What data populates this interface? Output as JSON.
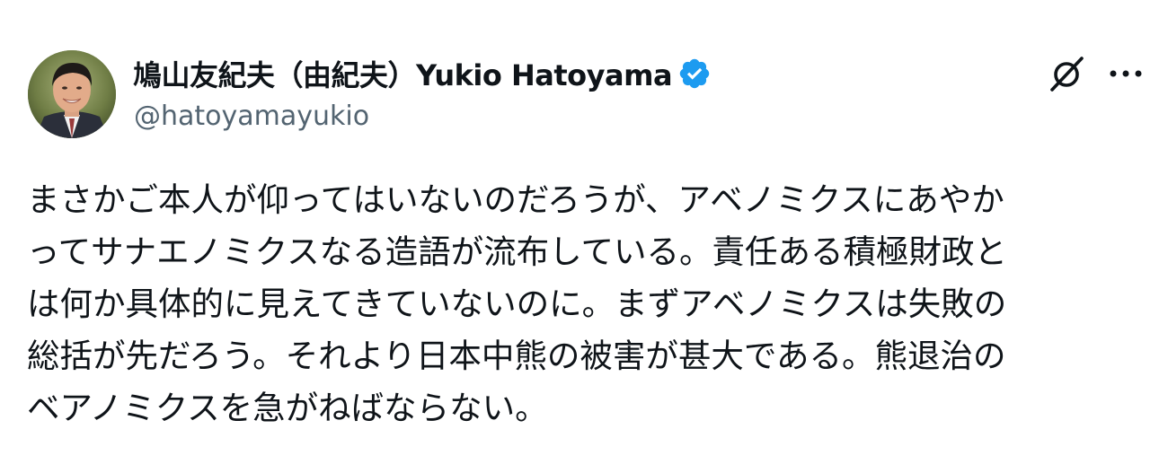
{
  "author": {
    "display_name": "鳩山友紀夫（由紀夫）Yukio Hatoyama",
    "handle": "@hatoyamayukio",
    "verified": true,
    "verified_color": "#1d9bf0",
    "avatar_icon": "profile-photo"
  },
  "actions": {
    "grok_icon": "grok-icon",
    "more_icon": "more-options-icon"
  },
  "tweet": {
    "lines": [
      "まさかご本人が仰ってはいないのだろうが、アベノミクスにあやか",
      "ってサナエノミクスなる造語が流布している。責任ある積極財政と",
      "は何か具体的に見えてきていないのに。まずアベノミクスは失敗の",
      "総括が先だろう。それより日本中熊の被害が甚大である。熊退治の",
      "ベアノミクスを急がねばならない。"
    ]
  },
  "colors": {
    "text_primary": "#0f1419",
    "text_secondary": "#536471",
    "background": "#ffffff"
  }
}
